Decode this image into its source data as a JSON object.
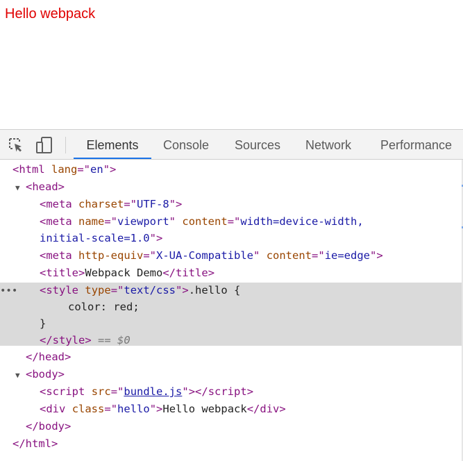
{
  "page": {
    "text": "Hello webpack",
    "text_color": "#e00000"
  },
  "devtools": {
    "tools": [
      {
        "name": "inspect-element",
        "icon": "cursor-select-icon"
      },
      {
        "name": "device-toolbar",
        "icon": "device-icon"
      }
    ],
    "tabs": [
      "Elements",
      "Console",
      "Sources",
      "Network",
      "Performance"
    ],
    "active_tab": "Elements",
    "accent_color": "#1a73e8",
    "selection_marker": "== $0",
    "dom": {
      "html_open": "html",
      "html_attr": "lang",
      "html_lang": "en",
      "head": "head",
      "meta1_attr": "charset",
      "meta1_val": "UTF-8",
      "meta2_attr1": "name",
      "meta2_val1": "viewport",
      "meta2_attr2": "content",
      "meta2_val2_a": "width=device-width,",
      "meta2_val2_b": "initial-scale=1.0",
      "meta3_attr1": "http-equiv",
      "meta3_val1": "X-UA-Compatible",
      "meta3_attr2": "content",
      "meta3_val2": "ie=edge",
      "meta": "meta",
      "title_tag": "title",
      "title_text": "Webpack Demo",
      "style_tag": "style",
      "style_attr": "type",
      "style_val": "text/css",
      "css_sel": ".hello {",
      "css_rule": "color: red;",
      "css_close": "}",
      "body": "body",
      "script_tag": "script",
      "script_attr": "src",
      "script_src": "bundle.js",
      "div_tag": "div",
      "div_attr": "class",
      "div_val": "hello",
      "div_text": "Hello webpack"
    }
  }
}
